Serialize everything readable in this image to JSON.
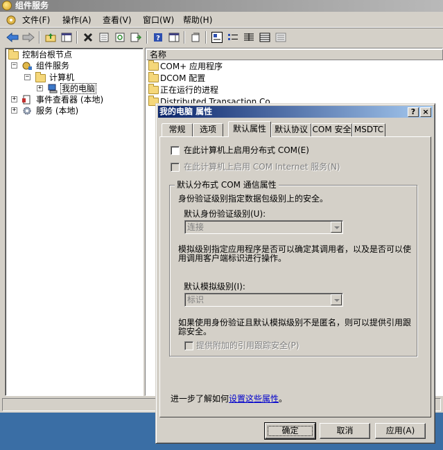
{
  "window": {
    "title": "组件服务"
  },
  "menu": [
    "文件(F)",
    "操作(A)",
    "查看(V)",
    "窗口(W)",
    "帮助(H)"
  ],
  "tree": {
    "root": "控制台根节点",
    "component_services": "组件服务",
    "computers": "计算机",
    "my_computer": "我的电脑",
    "event_viewer": "事件查看器 (本地)",
    "services": "服务 (本地)"
  },
  "list": {
    "header": "名称",
    "items": [
      "COM+ 应用程序",
      "DCOM 配置",
      "正在运行的进程",
      "Distributed Transaction Co"
    ]
  },
  "dialog": {
    "title": "我的电脑 属性",
    "help_button": "?",
    "close_button": "×",
    "tabs": [
      "常规",
      "选项",
      "默认属性",
      "默认协议",
      "COM 安全",
      "MSDTC"
    ],
    "active_tab": "默认属性",
    "enable_dcom": "在此计算机上启用分布式 COM(E)",
    "enable_com_internet": "在此计算机上启用 COM Internet 服务(N)",
    "group_title": "默认分布式 COM 通信属性",
    "auth_desc": "身份验证级别指定数据包级别上的安全。",
    "auth_label": "默认身份验证级别(U):",
    "auth_value": "连接",
    "impersonation_desc": "模拟级别指定应用程序是否可以确定其调用者，以及是否可以使用调用客户端标识进行操作。",
    "impersonation_label": "默认模拟级别(I):",
    "impersonation_value": "标识",
    "tracking_desc": "如果使用身份验证且默认模拟级别不是匿名，则可以提供引用跟踪安全。",
    "tracking_checkbox": "提供附加的引用跟踪安全(P)",
    "learn_more_prefix": "进一步了解如何",
    "learn_more_link": "设置这些属性",
    "learn_more_suffix": "。",
    "ok": "确定",
    "cancel": "取消",
    "apply": "应用(A)"
  }
}
